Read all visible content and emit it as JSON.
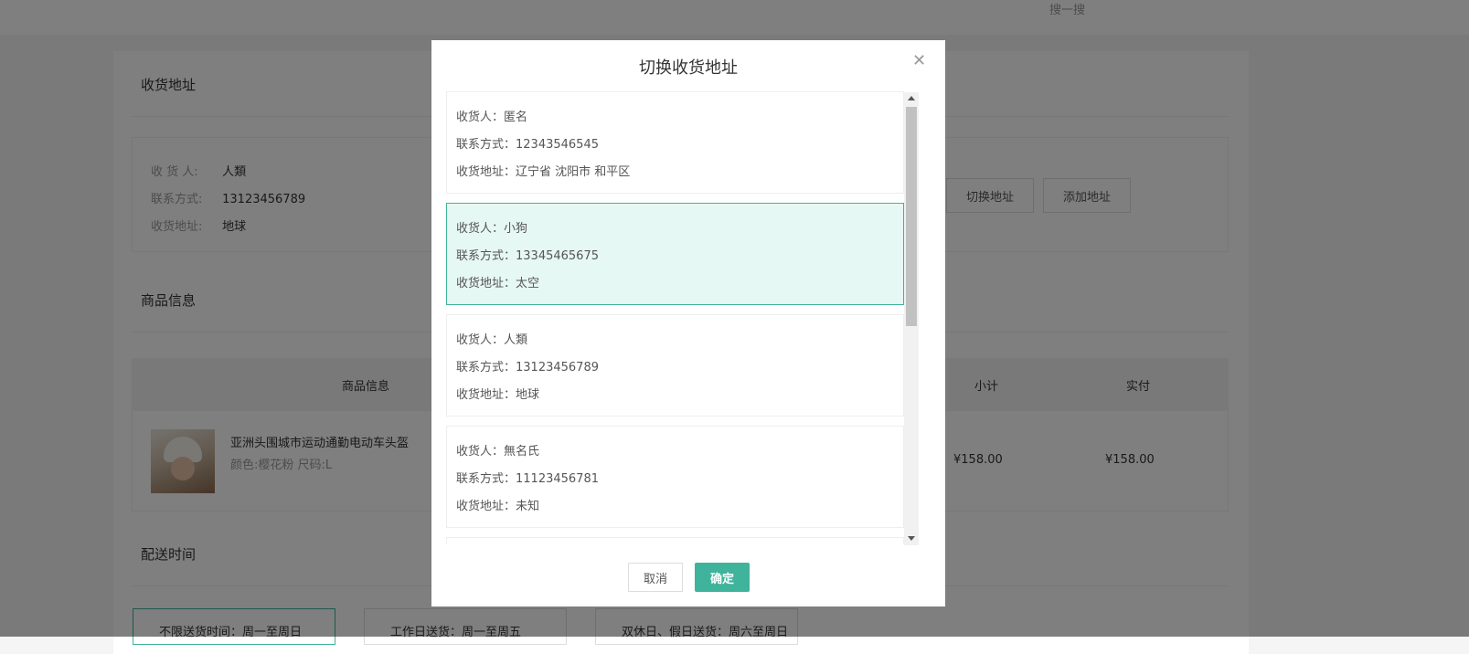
{
  "header": {
    "search_hint": "搜一搜"
  },
  "address_section": {
    "title": "收货地址",
    "consignee_label": "收 货 人:",
    "consignee": "人類",
    "phone_label": "联系方式:",
    "phone": "13123456789",
    "address_label": "收货地址:",
    "address": "地球",
    "switch_button": "切换地址",
    "add_button": "添加地址"
  },
  "goods_section": {
    "title": "商品信息",
    "columns": [
      "商品信息",
      "小计",
      "实付"
    ],
    "item": {
      "name": "亚洲头围城市运动通勤电动车头盔",
      "spec": "颜色:樱花粉 尺码:L",
      "subtotal": "¥158.00",
      "paid": "¥158.00"
    }
  },
  "delivery_section": {
    "title": "配送时间",
    "options": [
      "不限送货时间：周一至周日",
      "工作日送货：周一至周五",
      "双休日、假日送货：周六至周日"
    ]
  },
  "modal": {
    "title": "切换收货地址",
    "addresses": [
      {
        "consignee": "收货人：匿名",
        "phone": "联系方式：12343546545",
        "address": "收货地址：辽宁省 沈阳市 和平区"
      },
      {
        "consignee": "收货人：小狗",
        "phone": "联系方式：13345465675",
        "address": "收货地址：太空"
      },
      {
        "consignee": "收货人：人類",
        "phone": "联系方式：13123456789",
        "address": "收货地址：地球"
      },
      {
        "consignee": "收货人：無名氏",
        "phone": "联系方式：11123456781",
        "address": "收货地址：未知"
      }
    ],
    "selected_index": 1,
    "cancel_label": "取消",
    "confirm_label": "确定"
  },
  "colors": {
    "accent": "#3fb39b",
    "selected_bg": "#e6f8f4"
  },
  "icons": {
    "close": "close-icon"
  }
}
